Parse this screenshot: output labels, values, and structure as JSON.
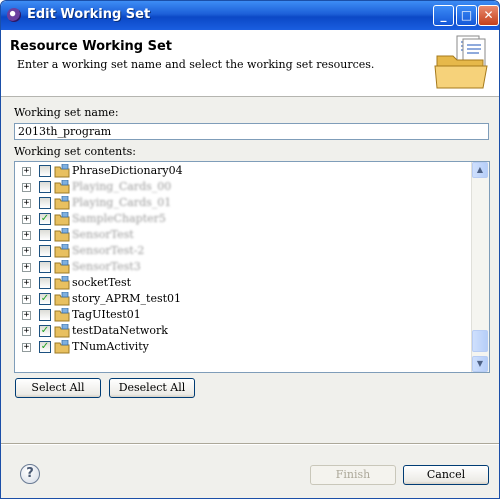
{
  "window": {
    "title": "Edit Working Set",
    "controls": {
      "minimize": "_",
      "maximize": "□",
      "close": "✕"
    }
  },
  "header": {
    "title": "Resource Working Set",
    "description": "Enter a working set name and select the working set resources.",
    "icon": "folder-documents-icon"
  },
  "name_field": {
    "label": "Working set name:",
    "value": "2013th_program"
  },
  "contents": {
    "label": "Working set contents:",
    "items": [
      {
        "label": "PhraseDictionary04",
        "checked": false,
        "blurred": false
      },
      {
        "label": "Playing_Cards_00",
        "checked": false,
        "blurred": true
      },
      {
        "label": "Playing_Cards_01",
        "checked": false,
        "blurred": true
      },
      {
        "label": "SampleChapter5",
        "checked": true,
        "blurred": true
      },
      {
        "label": "SensorTest",
        "checked": false,
        "blurred": true
      },
      {
        "label": "SensorTest-2",
        "checked": false,
        "blurred": true
      },
      {
        "label": "SensorTest3",
        "checked": false,
        "blurred": true
      },
      {
        "label": "socketTest",
        "checked": false,
        "blurred": false
      },
      {
        "label": "story_APRM_test01",
        "checked": true,
        "blurred": false
      },
      {
        "label": "TagUItest01",
        "checked": false,
        "blurred": false
      },
      {
        "label": "testDataNetwork",
        "checked": true,
        "blurred": false
      },
      {
        "label": "TNumActivity",
        "checked": true,
        "blurred": false
      }
    ],
    "checkmark": "✓",
    "expander": "+",
    "scroll_up": "▲",
    "scroll_down": "▼"
  },
  "buttons": {
    "select_all": "Select All",
    "deselect_all": "Deselect All",
    "help": "?",
    "finish": "Finish",
    "cancel": "Cancel"
  },
  "colors": {
    "titlebar": "#0b48c6",
    "dialog_bg": "#f0f0ec",
    "check_green": "#21a121"
  }
}
